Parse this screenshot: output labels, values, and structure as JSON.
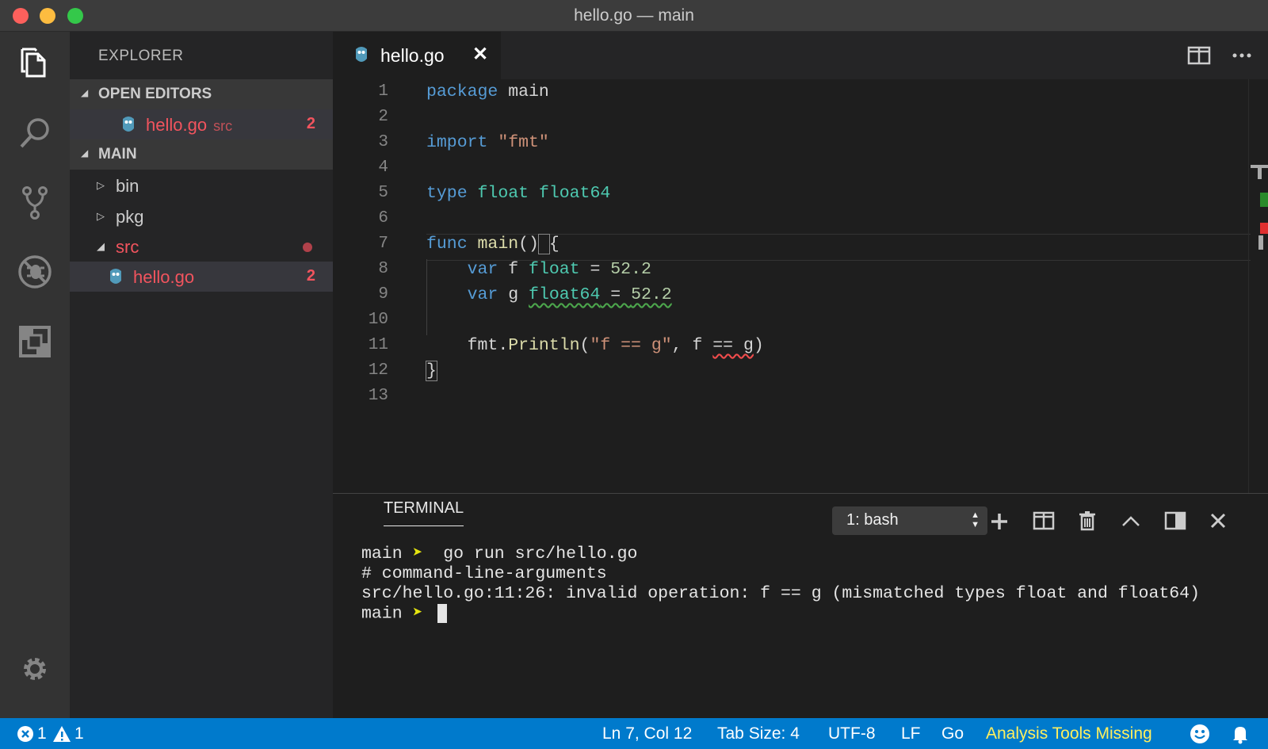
{
  "window": {
    "title": "hello.go — main"
  },
  "explorer": {
    "title": "EXPLORER",
    "open_editors": {
      "header": "OPEN EDITORS",
      "items": [
        {
          "name": "hello.go",
          "folder": "src",
          "problems": "2"
        }
      ]
    },
    "workspace": {
      "header": "MAIN",
      "items": [
        {
          "name": "bin"
        },
        {
          "name": "pkg"
        },
        {
          "name": "src"
        },
        {
          "name": "hello.go",
          "problems": "2"
        }
      ]
    }
  },
  "editor": {
    "tab": {
      "name": "hello.go",
      "close": "✕"
    },
    "line_numbers": [
      "1",
      "2",
      "3",
      "4",
      "5",
      "6",
      "7",
      "8",
      "9",
      "10",
      "11",
      "12",
      "13"
    ],
    "code": [
      "package main",
      "",
      "import \"fmt\"",
      "",
      "type float float64",
      "",
      "func main() {",
      "    var f float = 52.2",
      "    var g float64 = 52.2",
      "",
      "    fmt.Println(\"f == g\", f == g)",
      "}",
      ""
    ]
  },
  "panel": {
    "tab": "TERMINAL",
    "terminal_select": "1: bash",
    "lines": {
      "prompt1_dir": "main",
      "prompt1_arrow": "➤",
      "prompt1_cmd": " go run src/hello.go",
      "out1": "# command-line-arguments",
      "out2": "src/hello.go:11:26: invalid operation: f == g (mismatched types float and float64)",
      "prompt2_dir": "main",
      "prompt2_arrow": "➤"
    }
  },
  "statusbar": {
    "errors": "1",
    "warnings": "1",
    "position": "Ln 7, Col 12",
    "tab_size": "Tab Size: 4",
    "encoding": "UTF-8",
    "eol": "LF",
    "language": "Go",
    "tools_warning": "Analysis Tools Missing"
  },
  "colors": {
    "activity_bar": "#333333",
    "sidebar": "#252526",
    "editor_bg": "#1e1e1e",
    "status_bar": "#007acc",
    "error": "#f2545e",
    "keyword": "#569cd6",
    "type": "#4ec9b0",
    "string": "#ce9178",
    "number": "#b5cea8"
  },
  "icons": [
    "files-icon",
    "search-icon",
    "source-control-icon",
    "debug-icon",
    "extensions-icon",
    "gear-icon",
    "split-editor-icon",
    "more-icon",
    "add-icon",
    "split-terminal-icon",
    "trash-icon",
    "chevron-up-icon",
    "maximize-panel-icon",
    "close-icon",
    "error-icon",
    "warning-icon",
    "smiley-icon",
    "bell-icon",
    "go-file-icon"
  ]
}
